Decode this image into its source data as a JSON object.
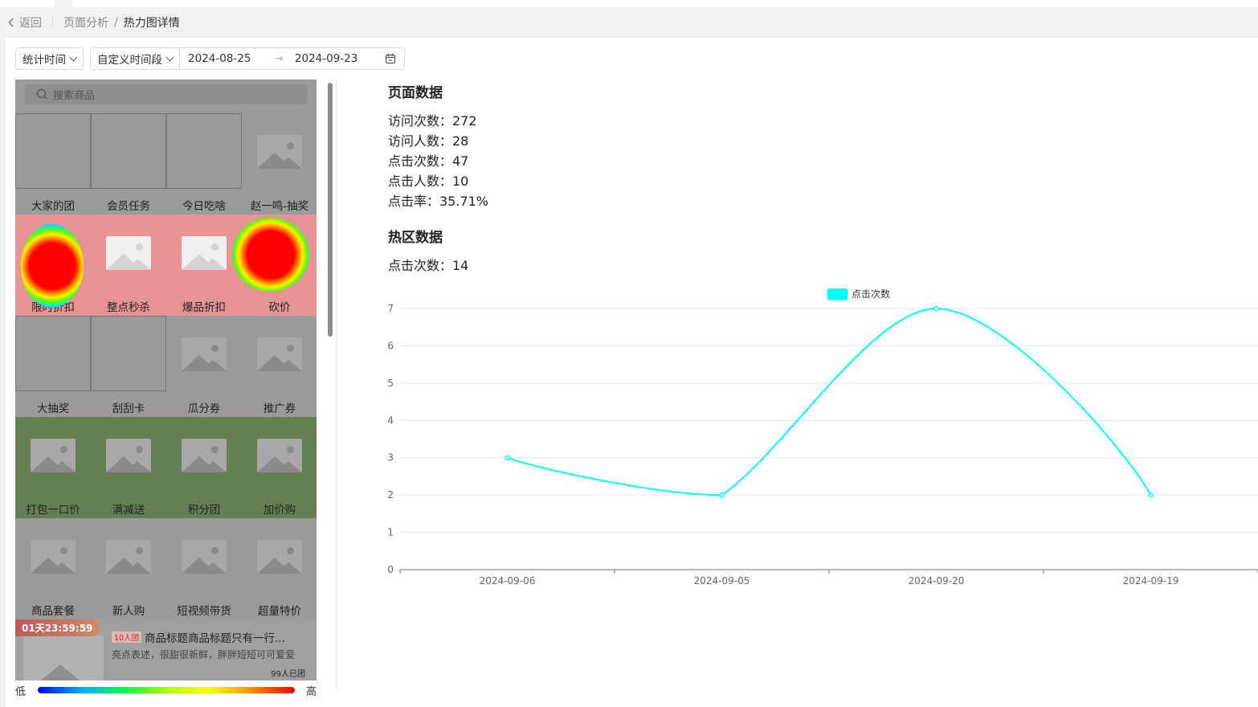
{
  "breadcrumb": {
    "back": "返回",
    "parent": "页面分析",
    "current": "热力图详情"
  },
  "filters": {
    "stat_time": "统计时间",
    "range_type": "自定义时间段",
    "start_date": "2024-08-25",
    "end_date": "2024-09-23",
    "arrow": "→"
  },
  "preview": {
    "search_placeholder": "搜索商品",
    "rows": [
      {
        "shade": "#9a9a9a",
        "items": [
          {
            "label": "大家的团",
            "kind": "box"
          },
          {
            "label": "会员任务",
            "kind": "box"
          },
          {
            "label": "今日吃啥",
            "kind": "box"
          },
          {
            "label": "赵一鸣-抽奖",
            "kind": "img"
          }
        ]
      },
      {
        "shade": "#e59393",
        "items": [
          {
            "label": "限时折扣",
            "kind": "img-light"
          },
          {
            "label": "整点秒杀",
            "kind": "img-light"
          },
          {
            "label": "爆品折扣",
            "kind": "img-light"
          },
          {
            "label": "砍价",
            "kind": "img-light"
          }
        ]
      },
      {
        "shade": "#9a9a9a",
        "items": [
          {
            "label": "大抽奖",
            "kind": "box"
          },
          {
            "label": "刮刮卡",
            "kind": "box"
          },
          {
            "label": "瓜分券",
            "kind": "img"
          },
          {
            "label": "推广券",
            "kind": "img"
          }
        ]
      },
      {
        "shade": "#648052",
        "items": [
          {
            "label": "打包一口价",
            "kind": "img"
          },
          {
            "label": "满减送",
            "kind": "img"
          },
          {
            "label": "积分团",
            "kind": "img"
          },
          {
            "label": "加价购",
            "kind": "img"
          }
        ]
      },
      {
        "shade": "#9a9a9a",
        "items": [
          {
            "label": "商品套餐",
            "kind": "img"
          },
          {
            "label": "新人购",
            "kind": "img"
          },
          {
            "label": "短视频带货",
            "kind": "img"
          },
          {
            "label": "超量特价",
            "kind": "img"
          }
        ]
      }
    ],
    "promo": {
      "countdown": "01天23:59:59",
      "tag": "10人团",
      "title": "商品标题商品标题只有一行...",
      "desc": "亮点表述，很甜很新鲜，胖胖短短可可爱爱",
      "joined": "99人已团"
    },
    "legend_low": "低",
    "legend_high": "高"
  },
  "page_data": {
    "title": "页面数据",
    "lines": [
      "访问次数：272",
      "访问人数：28",
      "点击次数：47",
      "点击人数：10",
      "点击率：35.71%"
    ]
  },
  "hot_data": {
    "title": "热区数据",
    "lines": [
      "点击次数：14"
    ]
  },
  "chart_data": {
    "type": "line",
    "categories": [
      "2024-09-06",
      "2024-09-05",
      "2024-09-20",
      "2024-09-19"
    ],
    "series": [
      {
        "name": "点击次数",
        "values": [
          3,
          2,
          7,
          2
        ],
        "color": "#00ffff"
      }
    ],
    "ylim": [
      0,
      7
    ],
    "yticks": [
      0,
      1,
      2,
      3,
      4,
      5,
      6,
      7
    ],
    "smooth": true,
    "grid": true,
    "legend_position": "top-center"
  }
}
